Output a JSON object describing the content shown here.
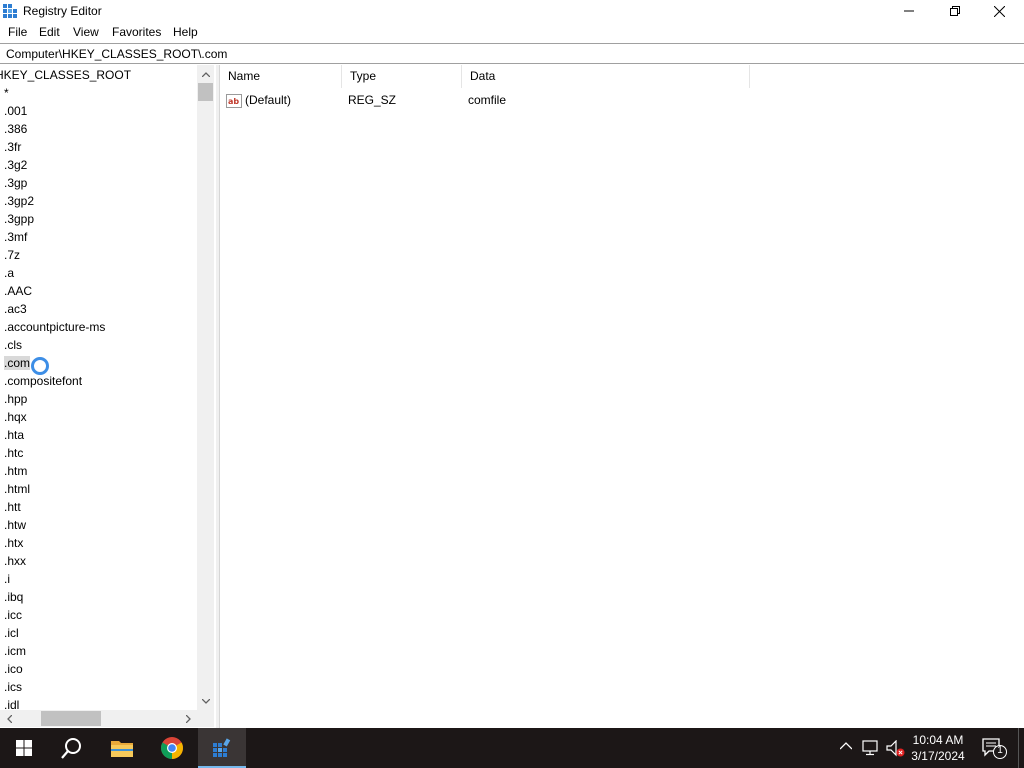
{
  "window": {
    "title": "Registry Editor"
  },
  "menu": [
    "File",
    "Edit",
    "View",
    "Favorites",
    "Help"
  ],
  "address": "Computer\\HKEY_CLASSES_ROOT\\.com",
  "tree": {
    "root": "HKEY_CLASSES_ROOT",
    "items": [
      "*",
      ".001",
      ".386",
      ".3fr",
      ".3g2",
      ".3gp",
      ".3gp2",
      ".3gpp",
      ".3mf",
      ".7z",
      ".a",
      ".AAC",
      ".ac3",
      ".accountpicture-ms",
      ".cls",
      ".com",
      ".compositefont",
      ".hpp",
      ".hqx",
      ".hta",
      ".htc",
      ".htm",
      ".html",
      ".htt",
      ".htw",
      ".htx",
      ".hxx",
      ".i",
      ".ibq",
      ".icc",
      ".icl",
      ".icm",
      ".ico",
      ".ics",
      ".idl"
    ],
    "selected": ".com"
  },
  "list": {
    "columns": [
      "Name",
      "Type",
      "Data"
    ],
    "rows": [
      {
        "name": "(Default)",
        "type": "REG_SZ",
        "data": "comfile"
      }
    ]
  },
  "taskbar": {
    "time": "10:04 AM",
    "date": "3/17/2024",
    "notification_count": "1"
  },
  "colors": {
    "taskbar_bg": "#1c1717",
    "selection_bg": "#d9d9d9",
    "active_indicator": "#76b9ed"
  }
}
